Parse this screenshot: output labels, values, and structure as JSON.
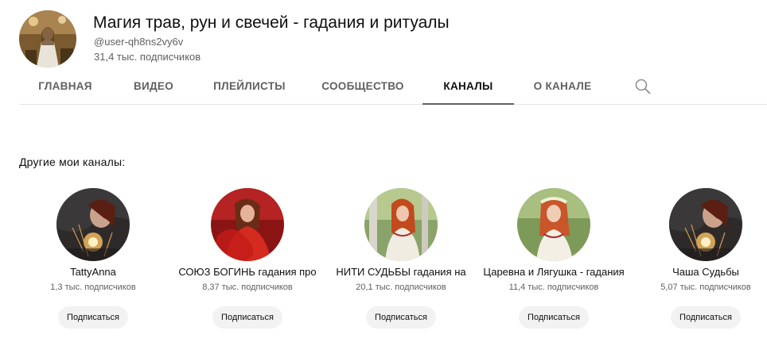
{
  "channel": {
    "title": "Магия трав, рун и свечей - гадания и ритуалы",
    "handle": "@user-qh8ns2vy6v",
    "subscribers": "31,4 тыс. подписчиков"
  },
  "tabs": [
    {
      "label": "ГЛАВНАЯ",
      "active": false
    },
    {
      "label": "ВИДЕО",
      "active": false
    },
    {
      "label": "ПЛЕЙЛИСТЫ",
      "active": false
    },
    {
      "label": "СООБЩЕСТВО",
      "active": false
    },
    {
      "label": "КАНАЛЫ",
      "active": true
    },
    {
      "label": "О КАНАЛЕ",
      "active": false
    }
  ],
  "search_icon": "search-icon",
  "section": {
    "title": "Другие мои каналы:"
  },
  "channels": [
    {
      "name": "TattyAnna",
      "subscribers": "1,3 тыс. подписчиков",
      "button": "Подписаться"
    },
    {
      "name": "СОЮЗ БОГИНЬ гадания про",
      "subscribers": "8,37 тыс. подписчиков",
      "button": "Подписаться"
    },
    {
      "name": "НИТИ СУДЬБЫ гадания на",
      "subscribers": "20,1 тыс. подписчиков",
      "button": "Подписаться"
    },
    {
      "name": "Царевна и Лягушка - гадания",
      "subscribers": "11,4 тыс. подписчиков",
      "button": "Подписаться"
    },
    {
      "name": "Чаша Судьбы",
      "subscribers": "5,07 тыс. подписчиков",
      "button": "Подписаться"
    }
  ],
  "colors": {
    "text_primary": "#0f0f0f",
    "text_secondary": "#606060",
    "button_bg": "#f2f2f2",
    "divider": "#e5e5e5"
  }
}
